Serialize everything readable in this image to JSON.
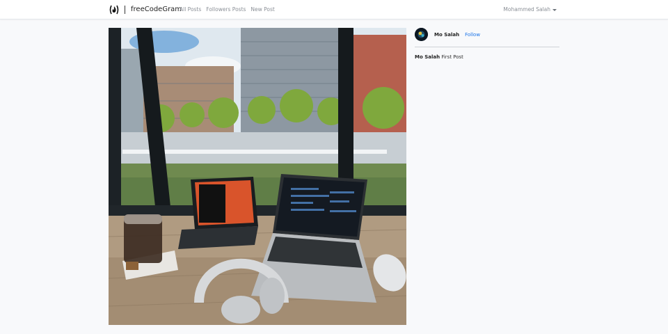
{
  "navbar": {
    "brand": "freeCodeGram",
    "links": [
      {
        "label": "All Posts"
      },
      {
        "label": "Followers Posts"
      },
      {
        "label": "New Post"
      }
    ],
    "user": "Mohammed Salah"
  },
  "post": {
    "author": "Mo Salah",
    "follow_label": "Follow",
    "caption_author": "Mo Salah",
    "caption_text": "First Post"
  },
  "colors": {
    "link": "#1a73e8",
    "nav_text": "#8a8f96",
    "background": "#f8f9fb"
  }
}
